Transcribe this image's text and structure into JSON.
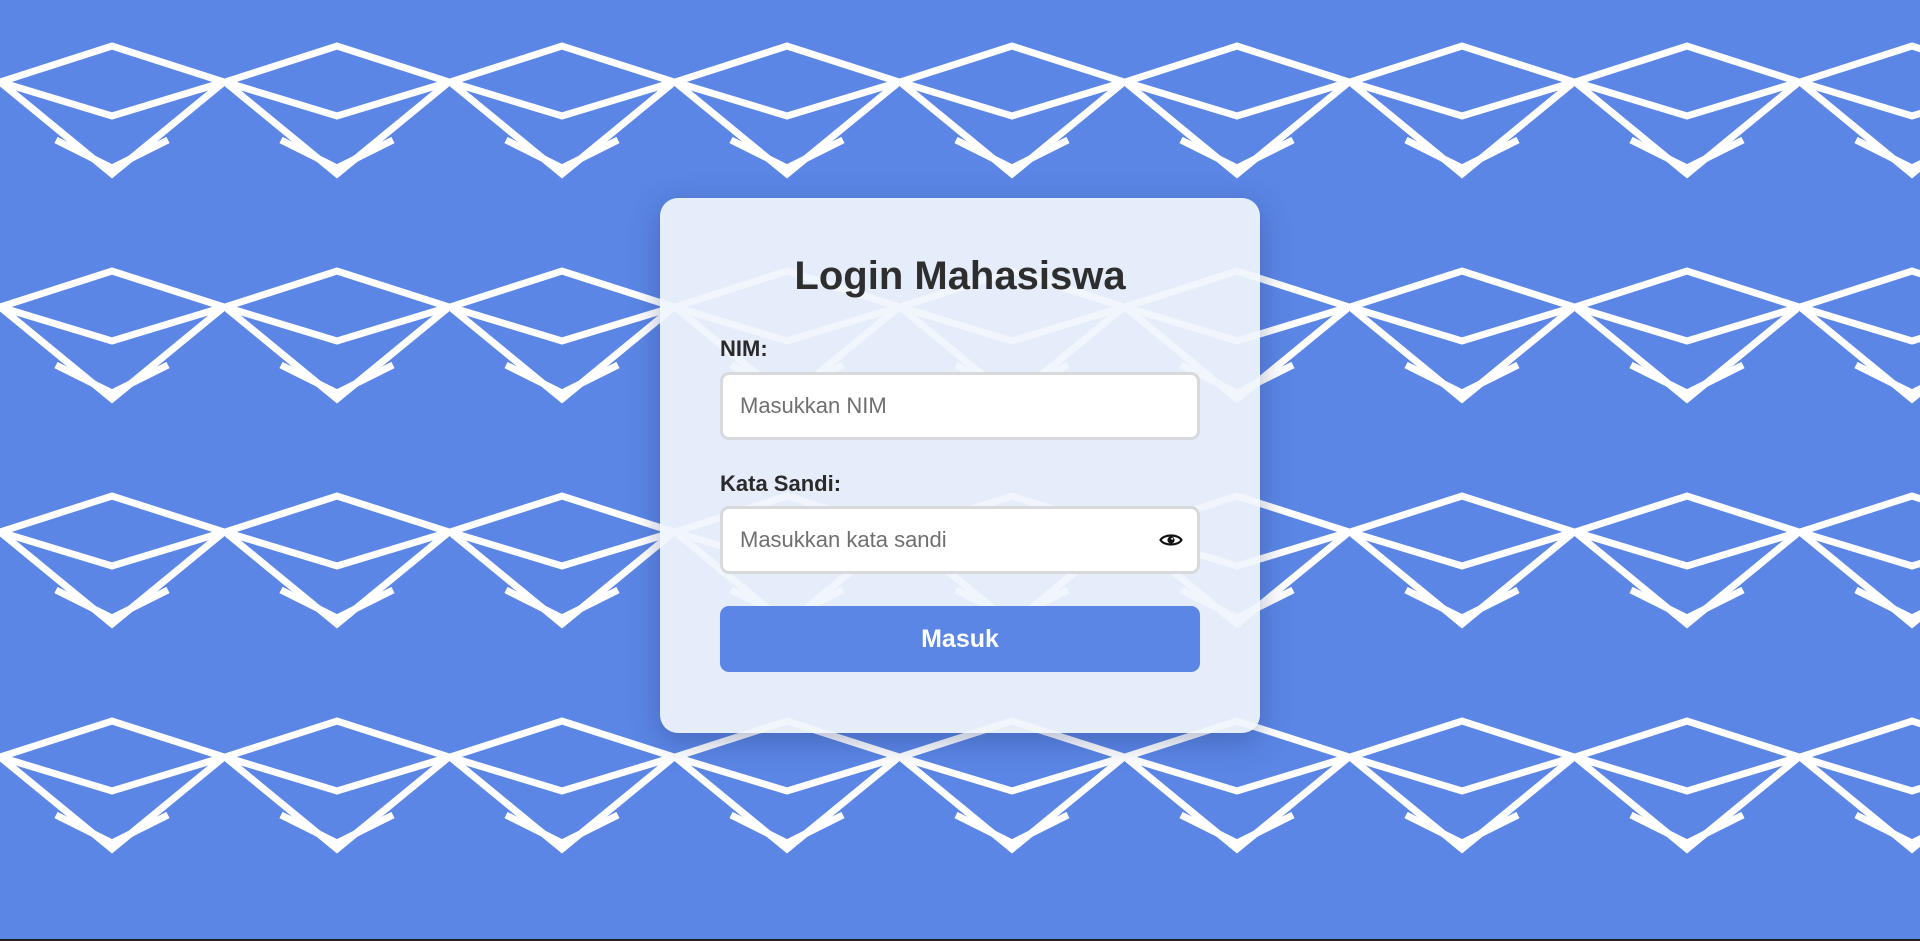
{
  "colors": {
    "background": "#5b86e5",
    "pattern": "#ffffff",
    "card": "#eef3fb",
    "button": "#5b86e5",
    "button_text": "#ffffff",
    "title_text": "#2e2e2e"
  },
  "background": {
    "pattern_icon": "graduation-cap-icon"
  },
  "login": {
    "title": "Login Mahasiswa",
    "nim_label": "NIM:",
    "nim_placeholder": "Masukkan NIM",
    "nim_value": "",
    "password_label": "Kata Sandi:",
    "password_placeholder": "Masukkan kata sandi",
    "password_value": "",
    "show_password_icon": "eye-icon",
    "submit_label": "Masuk"
  }
}
